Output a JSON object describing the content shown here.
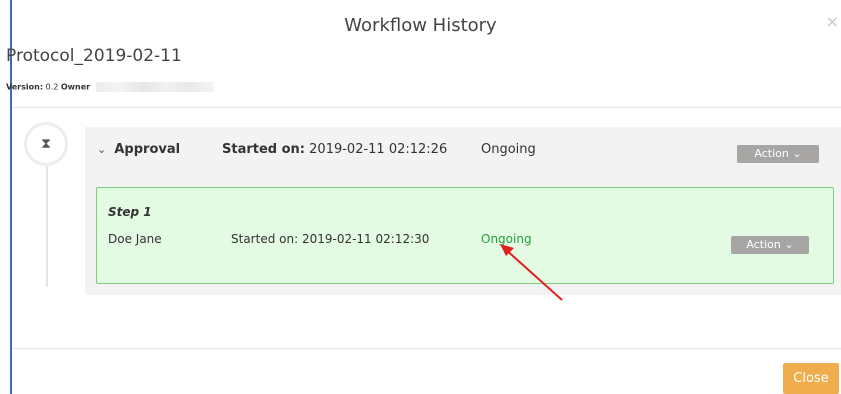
{
  "modal": {
    "title": "Workflow History",
    "close_icon": "×"
  },
  "document": {
    "name": "Protocol_2019-02-11",
    "version_label": "Version:",
    "version_value": "0.2",
    "owner_label": "Owner"
  },
  "timeline": {
    "badge_icon": "⧗"
  },
  "approval": {
    "chevron": "⌄",
    "label": "Approval",
    "started_label": "Started on:",
    "started_value": "2019-02-11 02:12:26",
    "status": "Ongoing",
    "action_label": "Action ⌄"
  },
  "step": {
    "title": "Step 1",
    "person": "Doe Jane",
    "started_label": "Started on:",
    "started_value": "2019-02-11 02:12:30",
    "status": "Ongoing",
    "action_label": "Action ⌄"
  },
  "footer": {
    "close_label": "Close"
  },
  "colors": {
    "accent_border": "#3a6fb4",
    "step_bg": "#e2fbe2",
    "step_border": "#7fcd7f",
    "status_green": "#2a9d3c",
    "action_btn": "#a8a5a5",
    "close_btn": "#f0ad4e",
    "annotation_arrow": "#e02020"
  }
}
